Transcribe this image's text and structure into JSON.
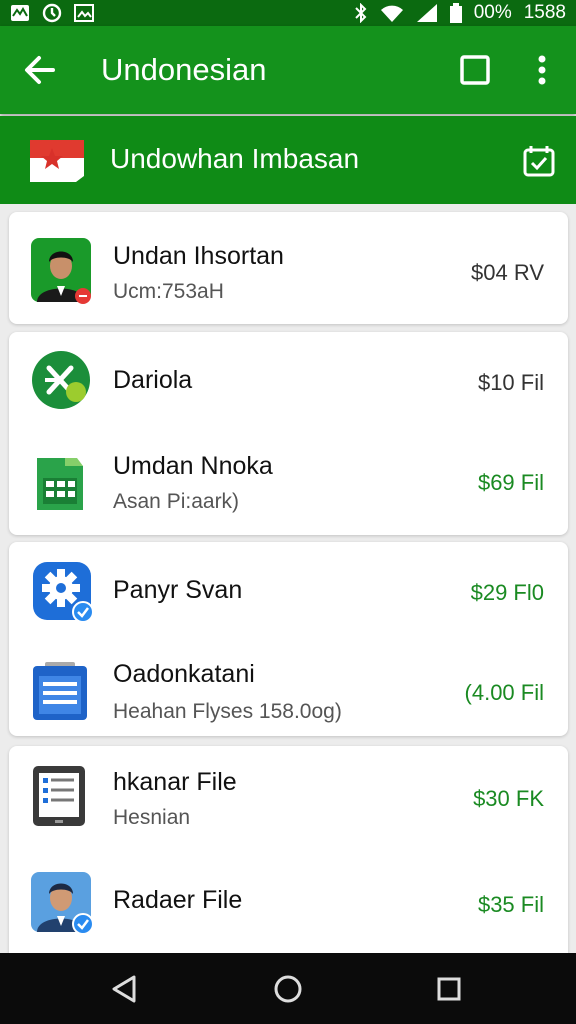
{
  "status_bar": {
    "battery": "00%",
    "time": "1588",
    "icons": [
      "message-icon",
      "sync-icon",
      "photo-icon",
      "bluetooth-icon",
      "wifi-icon",
      "signal-icon",
      "battery-icon"
    ]
  },
  "app_bar": {
    "title": "Undonesian",
    "icons": [
      "back-arrow-icon",
      "square-icon",
      "more-vert-icon"
    ]
  },
  "sub_header": {
    "label": "Undowhan Imbasan",
    "icons": [
      "flag-icon",
      "calendar-check-icon"
    ]
  },
  "cards": [
    {
      "items": [
        {
          "name": "Undan Ihsortan",
          "sub": "Ucm:753aH",
          "price": "$04 RV",
          "icon": "person-avatar-icon"
        }
      ]
    },
    {
      "items": [
        {
          "name": "Dariola",
          "sub": "",
          "price": "$10 Fil",
          "icon": "excel-app-icon"
        },
        {
          "name": "Umdan Nnoka",
          "sub": "Asan Pi:aark)",
          "price": "$69 Fil",
          "icon": "spreadsheet-icon"
        }
      ]
    },
    {
      "items": [
        {
          "name": "Panyr Svan",
          "sub": "",
          "price": "$29 Fl0",
          "icon": "settings-gear-icon"
        },
        {
          "name": "Oadonkatani",
          "sub": "Heahan Flyses 158.0og)",
          "price": "(4.00 Fil",
          "icon": "document-clipboard-icon"
        }
      ]
    },
    {
      "items": [
        {
          "name": "hkanar File",
          "sub": "Hesnian",
          "price": "$30 FK",
          "icon": "tablet-icon"
        },
        {
          "name": "Radaer File",
          "sub": "",
          "price": "$35 Fil",
          "icon": "person-avatar-verified-icon"
        }
      ]
    }
  ],
  "nav_bar": {
    "icons": [
      "back-triangle-icon",
      "home-circle-icon",
      "recents-square-icon"
    ]
  },
  "colors": {
    "app_bar": "#14921c",
    "status_bar": "#0b6a10",
    "sub_header": "#0f8b16",
    "price_green": "#1a8a22"
  }
}
